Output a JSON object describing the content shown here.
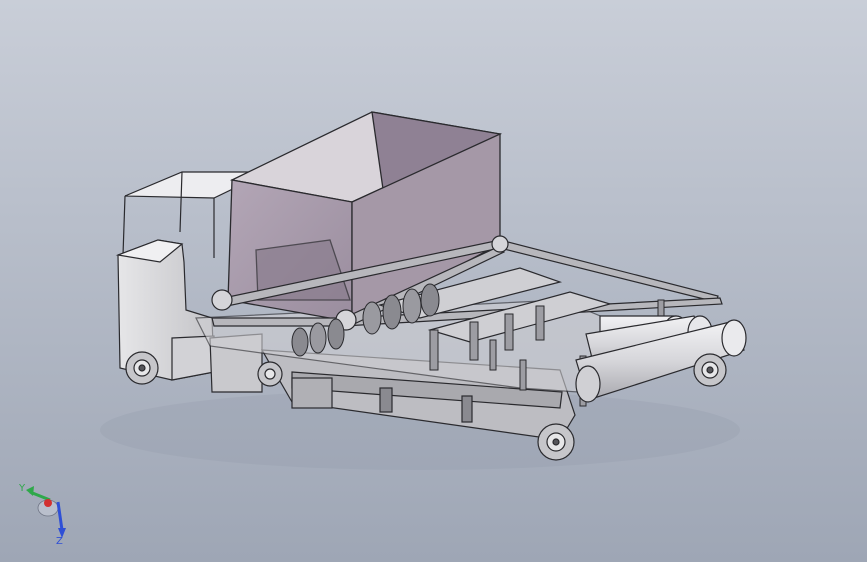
{
  "viewport": {
    "background_top": "#c9ced8",
    "background_bottom": "#9ea6b5"
  },
  "model": {
    "parts": [
      "cab-roof-frame",
      "cab-body",
      "hopper",
      "conveyor-frame",
      "spiral-auger",
      "seedling-trays",
      "roller-drum-assembly",
      "chassis-frame",
      "wheel"
    ],
    "colors": {
      "hopper": "#a598a7",
      "hopper_inner": "#8f8194",
      "metal": "#c8c8cc",
      "dark_metal": "#6d6d73",
      "roller": "#dcdce0",
      "outline": "#2a2a2e"
    }
  },
  "triad": {
    "x_color": "#d23030",
    "y_color": "#2fa84a",
    "z_color": "#2e4fd6",
    "labels": {
      "y": "Y",
      "z": "Z"
    }
  }
}
